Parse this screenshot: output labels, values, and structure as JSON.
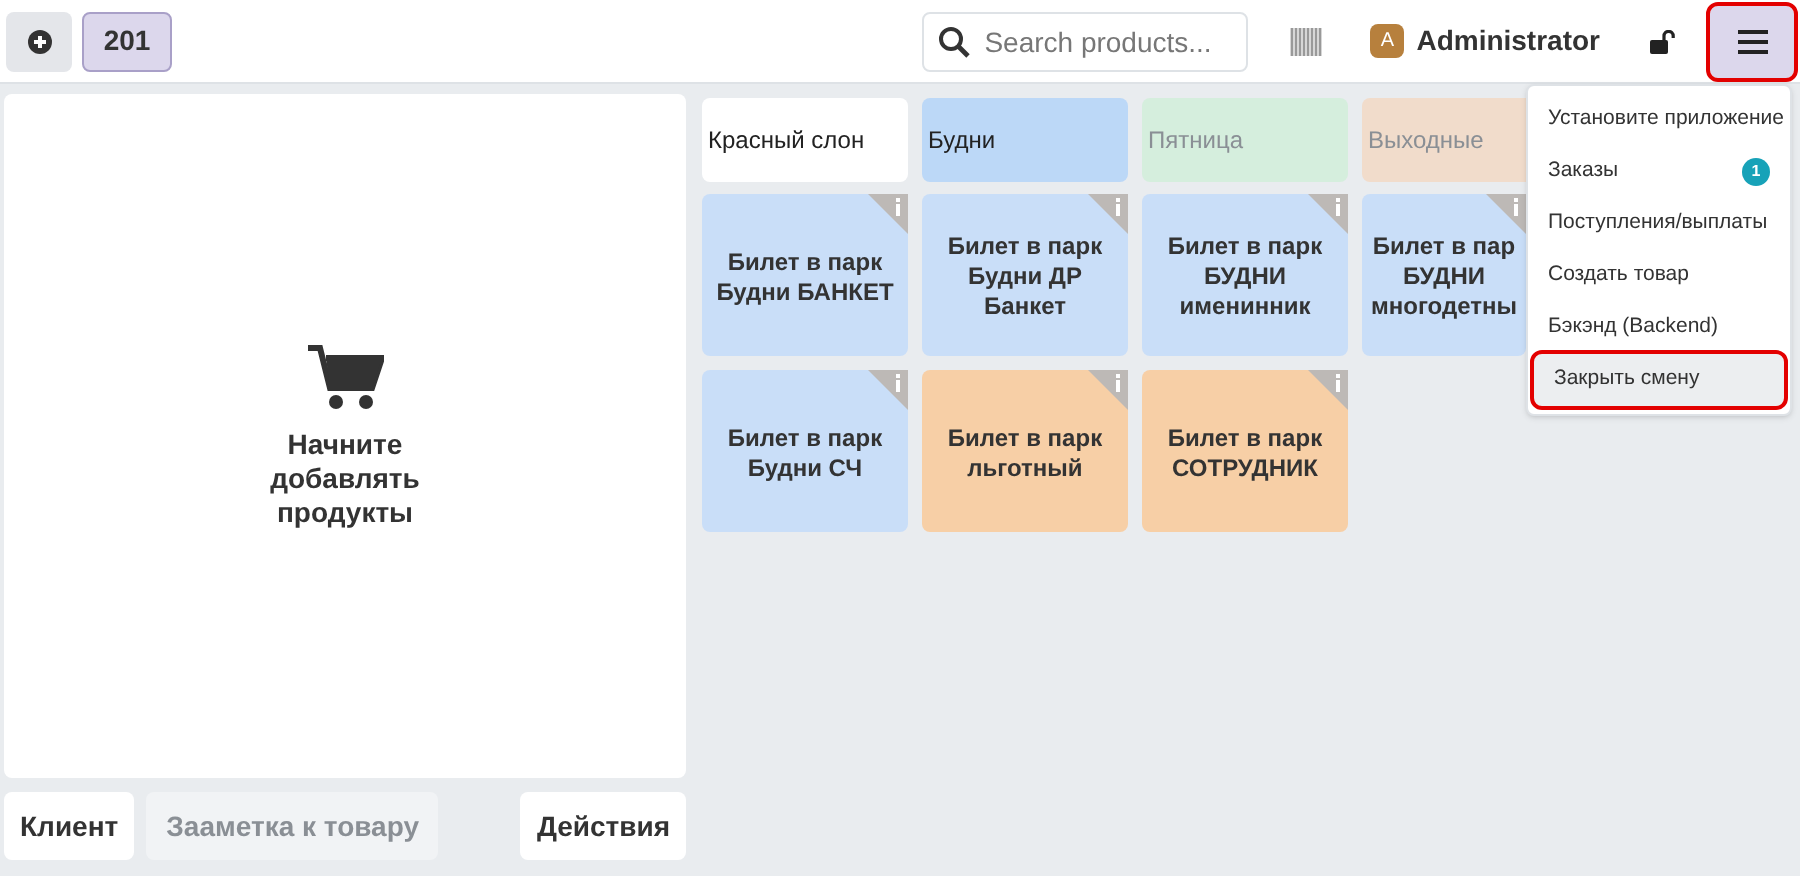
{
  "header": {
    "order_number": "201",
    "search": {
      "placeholder": "Search products..."
    },
    "user": {
      "initial": "A",
      "name": "Administrator"
    },
    "menu_button": {
      "highlighted": true
    }
  },
  "cart": {
    "empty_message": "Начните добавлять продукты"
  },
  "actions": [
    {
      "label": "Клиент",
      "disabled": false
    },
    {
      "label": "Зааметка к товару",
      "disabled": true
    },
    {
      "label": "Действия",
      "disabled": false
    }
  ],
  "categories": [
    {
      "label": "Красный слон",
      "color": "#ffffff",
      "dim": false
    },
    {
      "label": "Будни",
      "color": "#bcd8f7",
      "dim": false
    },
    {
      "label": "Пятница",
      "color": "#d5eedd",
      "dim": true
    },
    {
      "label": "Выходные",
      "color": "#f1dccb",
      "dim": true
    }
  ],
  "products": [
    {
      "lines": [
        "Билет в парк",
        "Будни БАНКЕТ"
      ],
      "color": "#c9def8"
    },
    {
      "lines": [
        "Билет в парк",
        "Будни ДР",
        "Банкет"
      ],
      "color": "#c9def8"
    },
    {
      "lines": [
        "Билет в парк",
        "БУДНИ",
        "именинник"
      ],
      "color": "#c9def8"
    },
    {
      "lines": [
        "Билет в пар",
        "БУДНИ",
        "многодетны"
      ],
      "color": "#c9def8"
    },
    {
      "lines": [
        "Билет в парк",
        "Будни СЧ"
      ],
      "color": "#c9def8"
    },
    {
      "lines": [
        "Билет в парк",
        "льготный"
      ],
      "color": "#f7cfa6"
    },
    {
      "lines": [
        "Билет в парк",
        "СОТРУДНИК"
      ],
      "color": "#f7cfa6"
    }
  ],
  "menu": [
    {
      "label": "Установите приложение",
      "highlighted": false
    },
    {
      "label": "Заказы",
      "badge": "1",
      "highlighted": false
    },
    {
      "label": "Поступления/выплаты",
      "highlighted": false
    },
    {
      "label": "Создать товар",
      "highlighted": false
    },
    {
      "label": "Бэкэнд (Backend)",
      "highlighted": false
    },
    {
      "label": "Закрыть смену",
      "highlighted": true
    }
  ]
}
